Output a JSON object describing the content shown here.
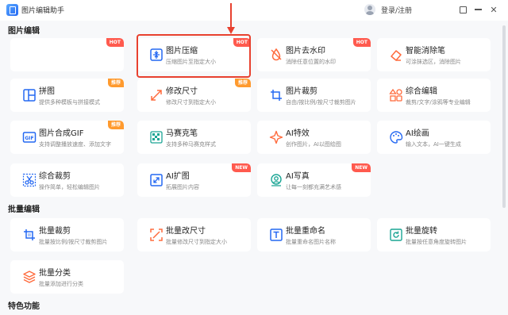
{
  "window": {
    "title": "图片编辑助手",
    "login": "登录/注册"
  },
  "sections": {
    "edit": "图片编辑",
    "batch": "批量编辑",
    "special": "特色功能"
  },
  "badges": {
    "hot": "HOT",
    "new": "NEW",
    "rec": "推荐"
  },
  "cards": {
    "blank": {
      "badge": "HOT"
    },
    "compress": {
      "title": "图片压缩",
      "sub": "压缩图片至指定大小",
      "badge": "HOT"
    },
    "watermark": {
      "title": "图片去水印",
      "sub": "消除任意位置的水印",
      "badge": "HOT"
    },
    "eraser": {
      "title": "智能消除笔",
      "sub": "可涂抹选区，消除图片"
    },
    "puzzle": {
      "title": "拼图",
      "sub": "提供多种模板与拼接模式",
      "badge": "推荐"
    },
    "resize": {
      "title": "修改尺寸",
      "sub": "修改尺寸到指定大小",
      "badge": "推荐"
    },
    "crop": {
      "title": "图片裁剪",
      "sub": "自由/按比例/按尺寸裁剪图片"
    },
    "composite": {
      "title": "综合编辑",
      "sub": "裁剪/文字/涂鸦等专业编辑"
    },
    "gif": {
      "title": "图片合成GIF",
      "sub": "支持调整播放速度、添加文字",
      "badge": "推荐"
    },
    "mosaic": {
      "title": "马赛克笔",
      "sub": "支持多种马赛克样式"
    },
    "effects": {
      "title": "AI特效",
      "sub": "创作图片，AI以图绘图"
    },
    "aidraw": {
      "title": "AI绘画",
      "sub": "输入文本，AI一键生成"
    },
    "compcrop": {
      "title": "综合裁剪",
      "sub": "操作简单，轻松编辑图片"
    },
    "expand": {
      "title": "AI扩图",
      "sub": "拓展图片内容",
      "badge": "NEW"
    },
    "portrait": {
      "title": "AI写真",
      "sub": "让每一刻都充满艺术感",
      "badge": "NEW"
    },
    "batch_crop": {
      "title": "批量裁剪",
      "sub": "批量按比例/按尺寸裁剪图片"
    },
    "batch_resize": {
      "title": "批量改尺寸",
      "sub": "批量修改尺寸到指定大小"
    },
    "batch_rename": {
      "title": "批量重命名",
      "sub": "批量重命名图片名称"
    },
    "batch_rotate": {
      "title": "批量旋转",
      "sub": "批量按任意角度旋转图片"
    },
    "batch_classify": {
      "title": "批量分类",
      "sub": "批量添加进行分类"
    }
  },
  "colors": {
    "accent": "#2468f2",
    "orange": "#ff6b3d",
    "highlight": "#e8412f"
  }
}
